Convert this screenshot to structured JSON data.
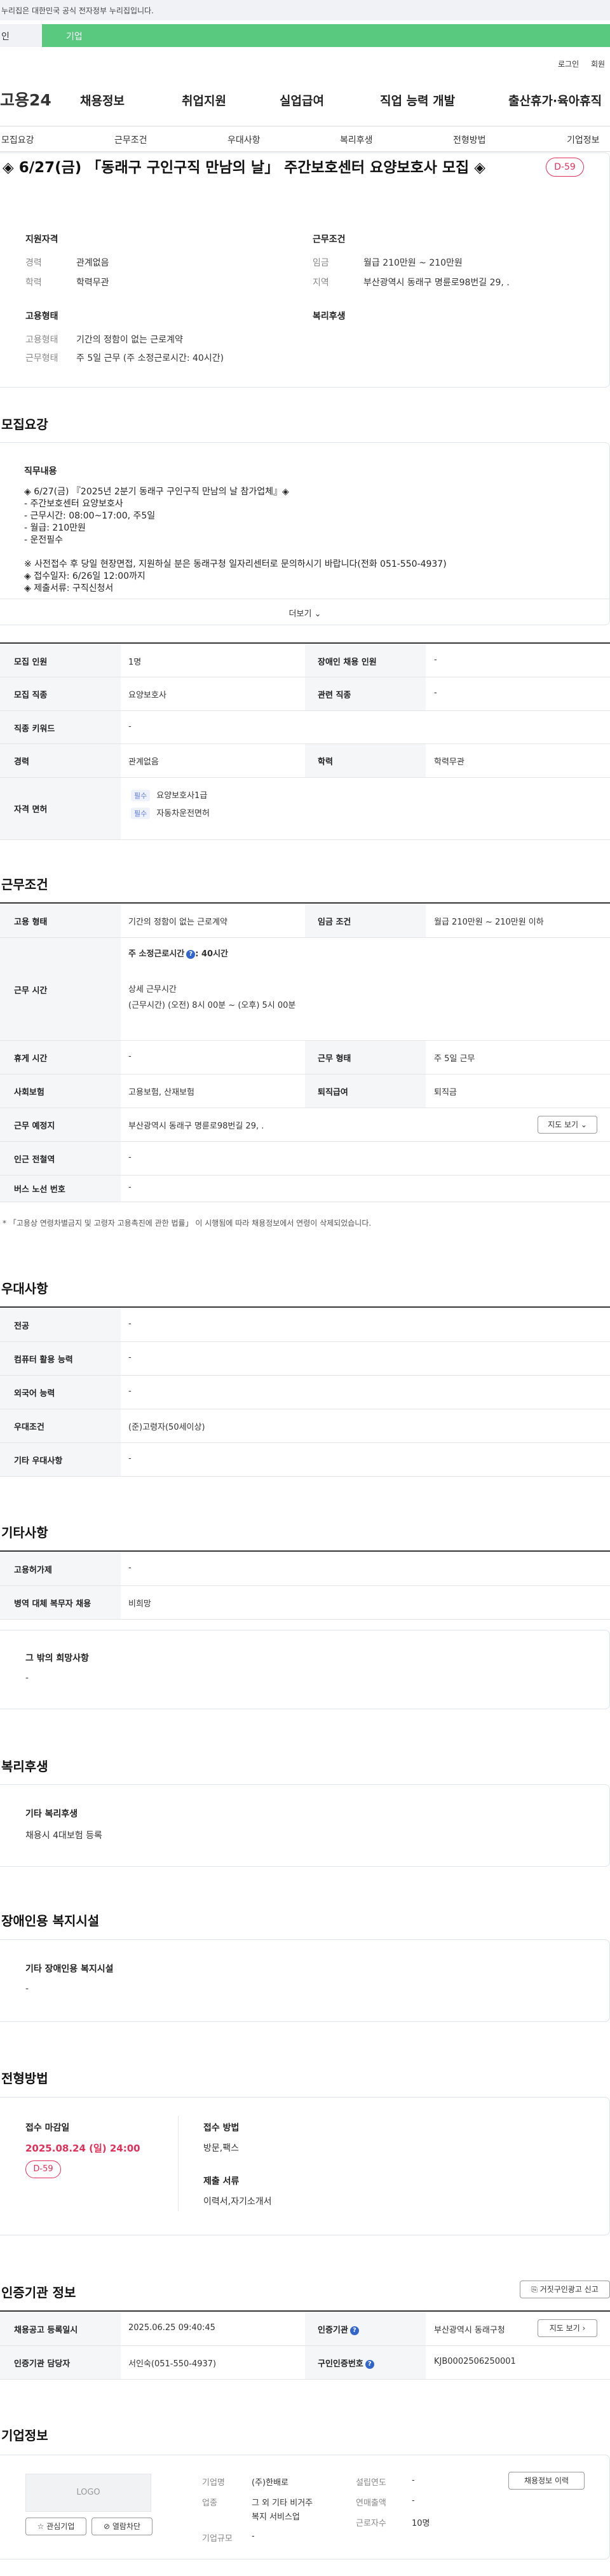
{
  "gov_banner": "누리집은 대한민국 공식 전자정부 누리집입니다.",
  "top_tabs": {
    "personal": "인",
    "company": "기업"
  },
  "util": {
    "login": "로그인",
    "signup": "회원"
  },
  "header": {
    "logo": "고용24",
    "nav": [
      "채용정보",
      "취업지원",
      "실업급여",
      "직업 능력 개발",
      "출산휴가·육아휴직"
    ]
  },
  "anchor_tabs": [
    "모집요강",
    "근무조건",
    "우대사항",
    "복리후생",
    "전형방법",
    "기업정보"
  ],
  "job": {
    "title": "◈ 6/27(금) 「동래구 구인구직 만남의 날」 주간보호센터 요양보호사 모집 ◈",
    "dday": "D-59"
  },
  "summary": {
    "qualification_label": "지원자격",
    "career_key": "경력",
    "career_val": "관계없음",
    "edu_key": "학력",
    "edu_val": "학력무관",
    "employment_label": "고용형태",
    "emp_type_key": "고용형태",
    "emp_type_val": "기간의 정함이 없는 근로계약",
    "work_form_key": "근무형태",
    "work_form_val": "주 5일 근무 (주 소정근로시간: 40시간)",
    "conditions_label": "근무조건",
    "wage_key": "임금",
    "wage_val": "월급 210만원 ~ 210만원",
    "region_key": "지역",
    "region_val": "부산광역시 동래구 명륜로98번길 29, .",
    "welfare_label": "복리후생"
  },
  "recruit": {
    "heading": "모집요강",
    "desc_title": "직무내용",
    "desc_lines": [
      "◈ 6/27(금) 『2025년 2분기 동래구 구인구직 만남의 날 참가업체』◈",
      "- 주간보호센터 요양보호사",
      "- 근무시간: 08:00~17:00, 주5일",
      "- 월급: 210만원",
      "- 운전필수",
      "",
      "※ 사전접수 후 당일 현장면접, 지원하실 분은 동래구청 일자리센터로 문의하시기 바랍니다(전화 051-550-4937)",
      "◈ 접수일자: 6/26일 12:00까지",
      "◈ 제출서류: 구직신청서"
    ],
    "more": "더보기",
    "table": {
      "headcount_k": "모집 인원",
      "headcount_v": "1명",
      "disabled_k": "장애인 채용 인원",
      "disabled_v": "-",
      "job_k": "모집 직종",
      "job_v": "요양보호사",
      "related_k": "관련 직종",
      "related_v": "-",
      "keyword_k": "직종 키워드",
      "keyword_v": "-",
      "career_k": "경력",
      "career_v": "관계없음",
      "edu_k": "학력",
      "edu_v": "학력무관",
      "license_k": "자격 면허",
      "licenses": [
        {
          "tag": "필수",
          "name": "요양보호사1급"
        },
        {
          "tag": "필수",
          "name": "자동차운전면허"
        }
      ]
    }
  },
  "conditions": {
    "heading": "근무조건",
    "emp_type_k": "고용 형태",
    "emp_type_v": "기간의 정함이 없는 근로계약",
    "wage_k": "임금 조건",
    "wage_v": "월급 210만원 ~ 210만원 이하",
    "hours_k": "근무 시간",
    "hours_weekly": "주 소정근로시간",
    "hours_weekly_val": ": 40시간",
    "hours_detail_title": "상세 근무시간",
    "hours_detail": "(근무시간) (오전) 8시 00분 ~ (오후) 5시 00분",
    "break_k": "휴게 시간",
    "break_v": "-",
    "work_form_k": "근무 형태",
    "work_form_v": "주 5일 근무",
    "insurance_k": "사회보험",
    "insurance_v": "고용보험, 산재보험",
    "severance_k": "퇴직급여",
    "severance_v": "퇴직금",
    "place_k": "근무 예정지",
    "place_v": "부산광역시 동래구 명륜로98번길 29, .",
    "map_btn": "지도 보기",
    "subway_k": "인근 전철역",
    "subway_v": "-",
    "bus_k": "버스 노선 번호",
    "bus_v": "-",
    "note": "* 「고용상 연령차별금지 및 고령자 고용촉진에 관한 법률」 이 시행됨에 따라 채용정보에서 연령이 삭제되었습니다."
  },
  "preference": {
    "heading": "우대사항",
    "major_k": "전공",
    "major_v": "-",
    "computer_k": "컴퓨터 활용 능력",
    "computer_v": "-",
    "language_k": "외국어 능력",
    "language_v": "-",
    "pref_k": "우대조건",
    "pref_v": "(준)고령자(50세이상)",
    "other_k": "기타 우대사항",
    "other_v": "-"
  },
  "other": {
    "heading": "기타사항",
    "permit_k": "고용허가제",
    "permit_v": "-",
    "military_k": "병역 대체 복무자 채용",
    "military_v": "비희망",
    "wish_title": "그 밖의 희망사항",
    "wish_v": "-"
  },
  "welfare": {
    "heading": "복리후생",
    "title": "기타 복리후생",
    "value": "채용시 4대보험 등록"
  },
  "facility": {
    "heading": "장애인용 복지시설",
    "title": "기타 장애인용 복지시설",
    "value": "-"
  },
  "selection": {
    "heading": "전형방법",
    "deadline_label": "접수 마감일",
    "deadline": "2025.08.24 (일) 24:00",
    "dday": "D-59",
    "method_label": "접수 방법",
    "method": "방문,팩스",
    "docs_label": "제출 서류",
    "docs": "이력서,자기소개서"
  },
  "auth": {
    "heading": "인증기관 정보",
    "report_btn": "거짓구인광고 신고",
    "reg_k": "채용공고 등록일시",
    "reg_v": "2025.06.25 09:40:45",
    "org_k": "인증기관",
    "org_v": "부산광역시 동래구청",
    "staff_k": "인증기관 담당자",
    "staff_v": "서인숙(051-550-4937)",
    "notice_k": "구인인증번호",
    "notice_v": "KJB0002506250001",
    "view_btn": "지도 보기"
  },
  "company": {
    "heading": "기업정보",
    "logo_text": "LOGO",
    "interest_btn": "관심기업",
    "block_btn": "열람차단",
    "name_k": "기업명",
    "name_v": "(주)한배로",
    "industry_k": "업종",
    "industry_v1": "그 외 기타 비거주",
    "industry_v2": "복지 서비스업",
    "size_k": "기업규모",
    "size_v": "-",
    "founded_k": "설립연도",
    "founded_v": "-",
    "sales_k": "연매출액",
    "sales_v": "-",
    "employees_k": "근로자수",
    "employees_v": "10명",
    "history_btn": "채용정보 이력"
  }
}
